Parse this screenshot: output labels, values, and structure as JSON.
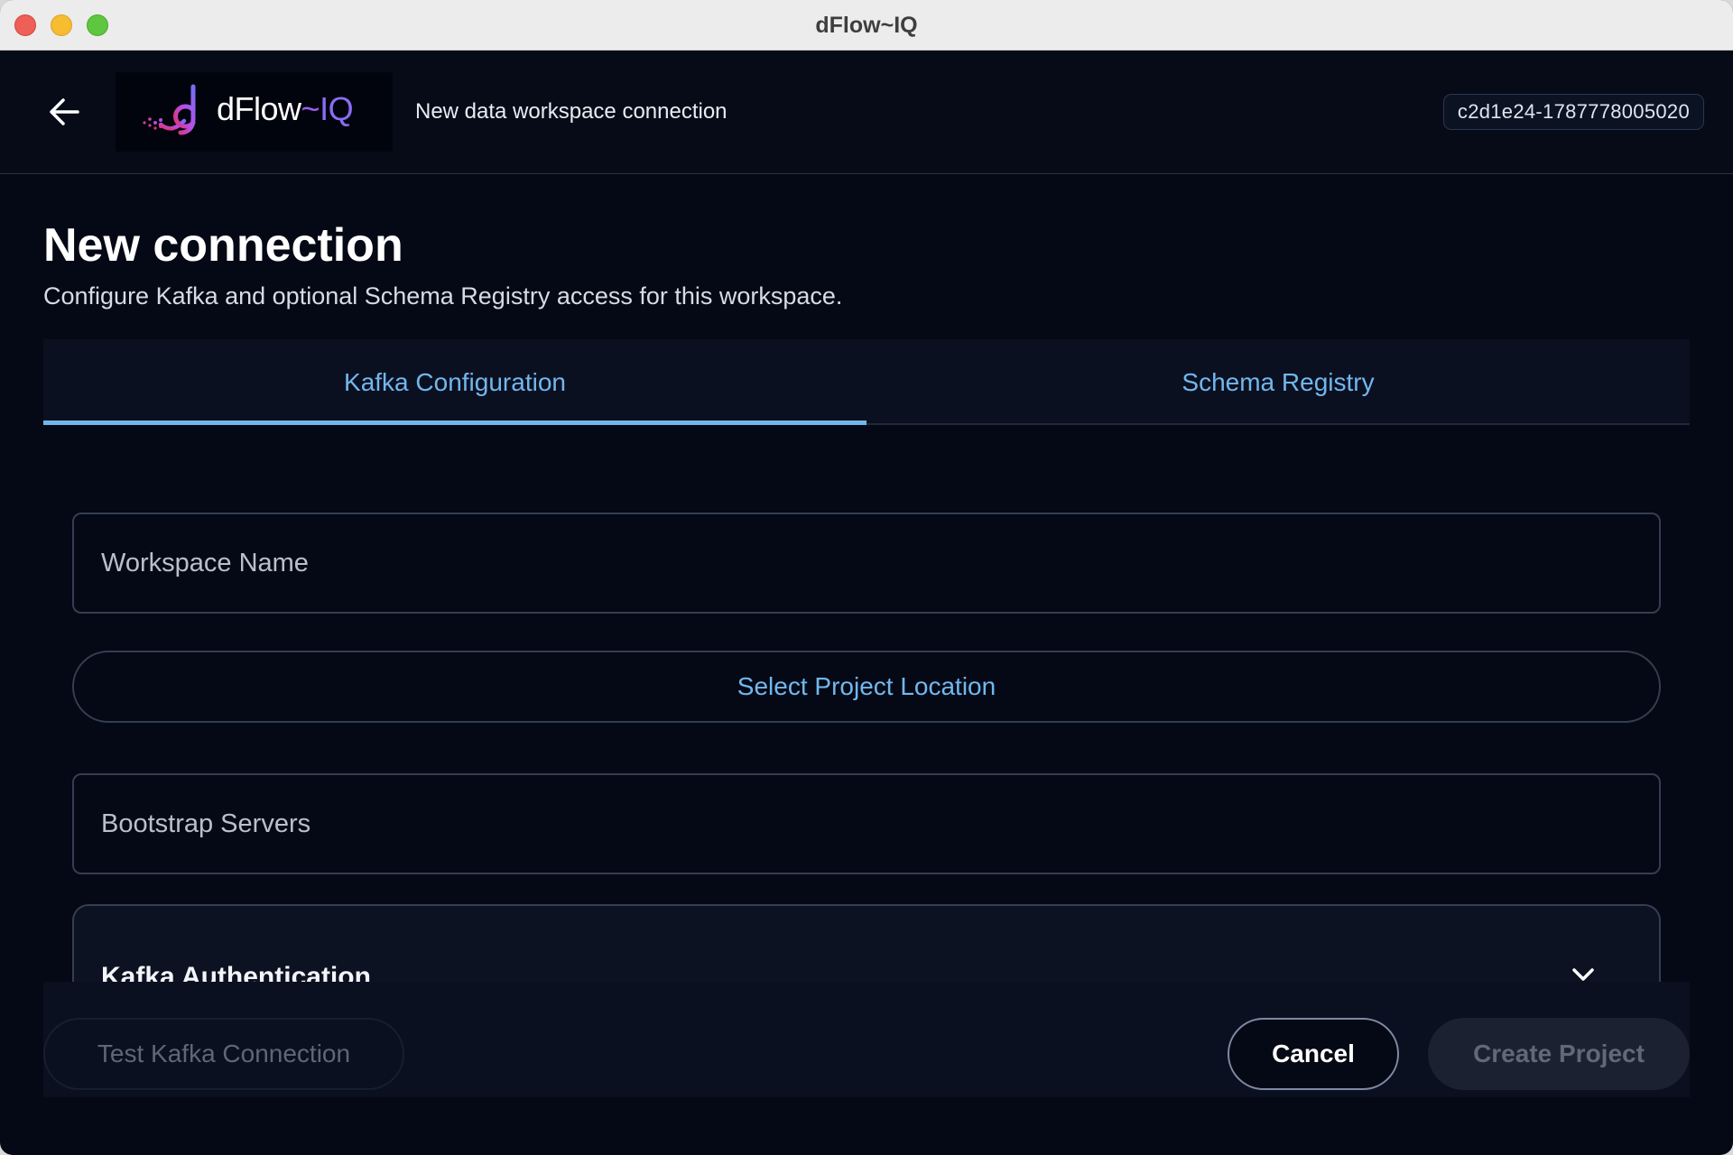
{
  "window": {
    "title": "dFlow~IQ"
  },
  "header": {
    "logo": {
      "name": "dFlow",
      "tilde": "~",
      "suffix": "IQ"
    },
    "subtitle": "New data workspace connection",
    "id_badge": "c2d1e24-1787778005020"
  },
  "main": {
    "title": "New connection",
    "description": "Configure Kafka and optional Schema Registry access for this workspace.",
    "tabs": [
      {
        "label": "Kafka Configuration",
        "active": true
      },
      {
        "label": "Schema Registry",
        "active": false
      }
    ],
    "fields": {
      "workspace_name": {
        "placeholder": "Workspace Name",
        "value": ""
      },
      "project_location_button": "Select Project Location",
      "bootstrap_servers": {
        "placeholder": "Bootstrap Servers",
        "value": ""
      }
    },
    "kafka_auth": {
      "title": "Kafka Authentication",
      "expanded": false
    }
  },
  "footer": {
    "test_button": "Test Kafka Connection",
    "cancel_button": "Cancel",
    "create_button": "Create Project"
  },
  "colors": {
    "background": "#050915",
    "accent": "#72b7ee",
    "logo_purple": "#a15cf0"
  }
}
